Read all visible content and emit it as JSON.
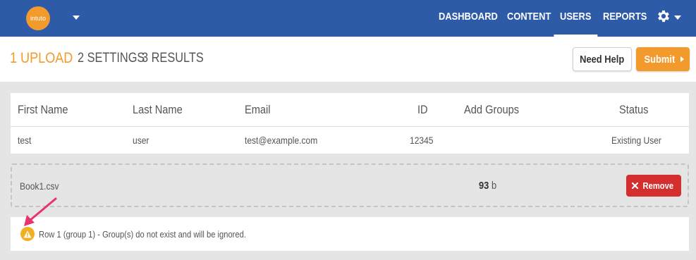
{
  "logo": {
    "text": "intuto"
  },
  "nav": {
    "items": [
      {
        "label": "DASHBOARD",
        "active": false
      },
      {
        "label": "CONTENT",
        "active": false
      },
      {
        "label": "USERS",
        "active": true
      },
      {
        "label": "REPORTS",
        "active": false
      }
    ]
  },
  "steps": [
    {
      "label": "1 UPLOAD",
      "active": true
    },
    {
      "label": "2 SETTINGS",
      "active": false
    },
    {
      "label": "3 RESULTS",
      "active": false
    }
  ],
  "header": {
    "help_label": "Need Help",
    "submit_label": "Submit"
  },
  "table": {
    "columns": [
      "First Name",
      "Last Name",
      "Email",
      "ID",
      "Add Groups",
      "Status"
    ],
    "rows": [
      {
        "first_name": "test",
        "last_name": "user",
        "email": "test@example.com",
        "id": "12345",
        "add_groups": "",
        "status": "Existing User"
      }
    ]
  },
  "file": {
    "name": "Book1.csv",
    "size_value": "93",
    "size_unit": "b",
    "remove_label": "Remove"
  },
  "warning": {
    "text": "Row 1 (group 1) - Group(s) do not exist and will be ignored."
  },
  "colors": {
    "nav_bg": "#2d5ba8",
    "accent": "#f39a2d",
    "danger": "#d32f2f",
    "warning": "#f0b020",
    "annotation_arrow": "#e8336b"
  },
  "icons": {
    "settings": "gear-icon",
    "warning": "warning-icon",
    "remove": "close-icon",
    "annotation": "arrow-annotation"
  }
}
